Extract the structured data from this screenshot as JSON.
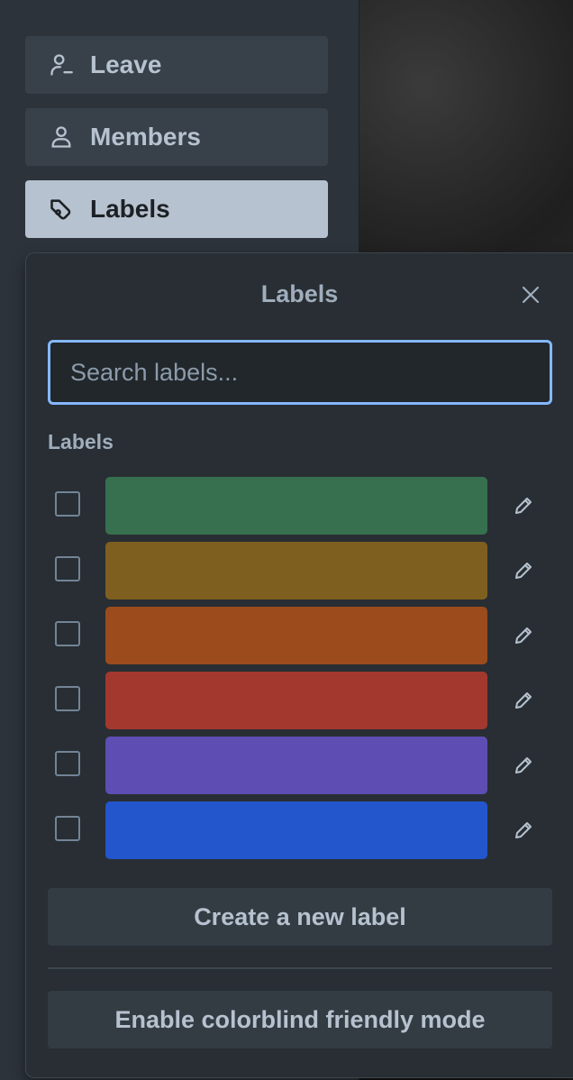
{
  "sidebar": {
    "items": [
      {
        "label": "Leave",
        "icon": "user-minus-icon"
      },
      {
        "label": "Members",
        "icon": "user-icon"
      },
      {
        "label": "Labels",
        "icon": "tag-icon",
        "active": true
      }
    ]
  },
  "popover": {
    "title": "Labels",
    "close_icon": "close-icon",
    "search_placeholder": "Search labels...",
    "search_value": "",
    "section_label": "Labels",
    "labels": [
      {
        "color": "#37704f",
        "checked": false
      },
      {
        "color": "#7f5f1f",
        "checked": false
      },
      {
        "color": "#9c4b1d",
        "checked": false
      },
      {
        "color": "#a3382f",
        "checked": false
      },
      {
        "color": "#5e4db2",
        "checked": false
      },
      {
        "color": "#2356cc",
        "checked": false
      }
    ],
    "create_label": "Create a new label",
    "colorblind_label": "Enable colorblind friendly mode"
  }
}
